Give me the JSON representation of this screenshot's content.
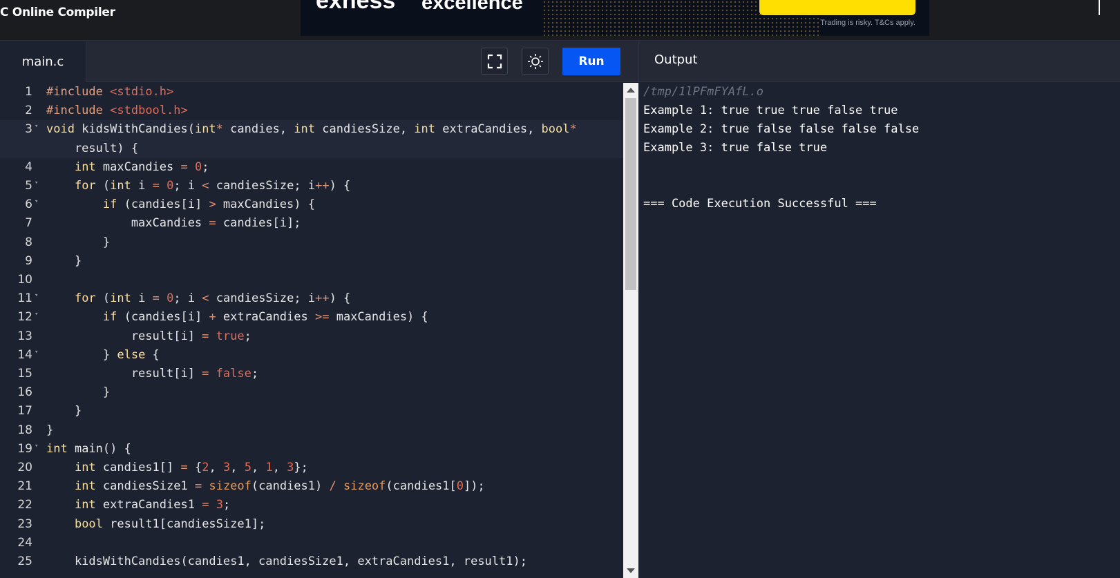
{
  "header": {
    "app_title": "C Online Compiler",
    "ad": {
      "brand": "exness",
      "tagline": "excellence",
      "disclaimer": "Trading is risky. T&Cs apply.",
      "cta_color": "#ffde02"
    }
  },
  "toolbar": {
    "file_tab": "main.c",
    "fullscreen_icon": "fullscreen-icon",
    "theme_icon": "sun-icon",
    "run_label": "Run",
    "run_color": "#0556f3"
  },
  "output": {
    "title": "Output",
    "path": "/tmp/1lPFmFYAfL.o",
    "lines": [
      "Example 1: true true true false true",
      "Example 2: true false false false false",
      "Example 3: true false true",
      "",
      "",
      "=== Code Execution Successful ==="
    ]
  },
  "editor": {
    "lines": [
      {
        "n": "1",
        "fold": false,
        "html": "<span class=\"pre\">#include</span> <span class=\"inc\">&lt;stdio.h&gt;</span>"
      },
      {
        "n": "2",
        "fold": false,
        "html": "<span class=\"pre\">#include</span> <span class=\"inc\">&lt;stdbool.h&gt;</span>"
      },
      {
        "n": "3",
        "fold": true,
        "active": true,
        "html": "<span class=\"ty\">void</span> kidsWithCandies(<span class=\"ty\">int</span><span class=\"op\">*</span> candies, <span class=\"ty\">int</span> candiesSize, <span class=\"ty\">int</span> extraCandies, <span class=\"ty\">bool</span><span class=\"op\">*</span>"
      },
      {
        "n": "",
        "fold": false,
        "active": true,
        "html": "    result) {"
      },
      {
        "n": "4",
        "fold": false,
        "html": "    <span class=\"ty\">int</span> maxCandies <span class=\"op\">=</span> <span class=\"num\">0</span>;"
      },
      {
        "n": "5",
        "fold": true,
        "html": "    <span class=\"kw\">for</span> (<span class=\"ty\">int</span> i <span class=\"op\">=</span> <span class=\"num\">0</span>; i <span class=\"op\">&lt;</span> candiesSize; i<span class=\"op\">++</span>) {"
      },
      {
        "n": "6",
        "fold": true,
        "html": "        <span class=\"kw\">if</span> (candies[i] <span class=\"op\">&gt;</span> maxCandies) {"
      },
      {
        "n": "7",
        "fold": false,
        "html": "            maxCandies <span class=\"op\">=</span> candies[i];"
      },
      {
        "n": "8",
        "fold": false,
        "html": "        }"
      },
      {
        "n": "9",
        "fold": false,
        "html": "    }"
      },
      {
        "n": "10",
        "fold": false,
        "html": ""
      },
      {
        "n": "11",
        "fold": true,
        "html": "    <span class=\"kw\">for</span> (<span class=\"ty\">int</span> i <span class=\"op\">=</span> <span class=\"num\">0</span>; i <span class=\"op\">&lt;</span> candiesSize; i<span class=\"op\">++</span>) {"
      },
      {
        "n": "12",
        "fold": true,
        "html": "        <span class=\"kw\">if</span> (candies[i] <span class=\"op\">+</span> extraCandies <span class=\"op\">&gt;=</span> maxCandies) {"
      },
      {
        "n": "13",
        "fold": false,
        "html": "            result[i] <span class=\"op\">=</span> <span class=\"lit\">true</span>;"
      },
      {
        "n": "14",
        "fold": true,
        "html": "        } <span class=\"kw\">else</span> {"
      },
      {
        "n": "15",
        "fold": false,
        "html": "            result[i] <span class=\"op\">=</span> <span class=\"lit\">false</span>;"
      },
      {
        "n": "16",
        "fold": false,
        "html": "        }"
      },
      {
        "n": "17",
        "fold": false,
        "html": "    }"
      },
      {
        "n": "18",
        "fold": false,
        "html": "}"
      },
      {
        "n": "19",
        "fold": true,
        "html": "<span class=\"ty\">int</span> main() {"
      },
      {
        "n": "20",
        "fold": false,
        "html": "    <span class=\"ty\">int</span> candies1[] <span class=\"op\">=</span> {<span class=\"num\">2</span>, <span class=\"num\">3</span>, <span class=\"num\">5</span>, <span class=\"num\">1</span>, <span class=\"num\">3</span>};"
      },
      {
        "n": "21",
        "fold": false,
        "html": "    <span class=\"ty\">int</span> candiesSize1 <span class=\"op\">=</span> <span class=\"fnc\">sizeof</span>(candies1) <span class=\"op\">/</span> <span class=\"fnc\">sizeof</span>(candies1[<span class=\"num\">0</span>]);"
      },
      {
        "n": "22",
        "fold": false,
        "html": "    <span class=\"ty\">int</span> extraCandies1 <span class=\"op\">=</span> <span class=\"num\">3</span>;"
      },
      {
        "n": "23",
        "fold": false,
        "html": "    <span class=\"ty\">bool</span> result1[candiesSize1];"
      },
      {
        "n": "24",
        "fold": false,
        "html": ""
      },
      {
        "n": "25",
        "fold": false,
        "html": "    kidsWithCandies(candies1, candiesSize1, extraCandies1, result1);"
      }
    ]
  }
}
